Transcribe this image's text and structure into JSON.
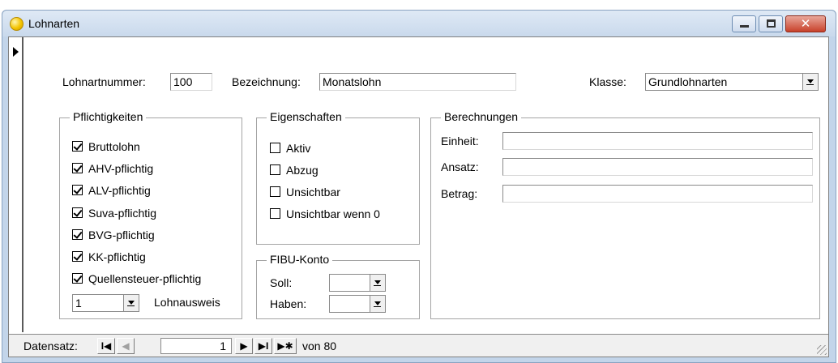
{
  "window": {
    "title": "Lohnarten",
    "close_glyph": "✕"
  },
  "header": {
    "lohnartnummer_label": "Lohnartnummer:",
    "lohnartnummer_value": "100",
    "bezeichnung_label": "Bezeichnung:",
    "bezeichnung_value": "Monatslohn",
    "klasse_label": "Klasse:",
    "klasse_value": "Grundlohnarten"
  },
  "pflichtigkeiten": {
    "title": "Pflichtigkeiten",
    "items": [
      {
        "label": "Bruttolohn",
        "checked": true
      },
      {
        "label": "AHV-pflichtig",
        "checked": true
      },
      {
        "label": "ALV-pflichtig",
        "checked": true
      },
      {
        "label": "Suva-pflichtig",
        "checked": true
      },
      {
        "label": "BVG-pflichtig",
        "checked": true
      },
      {
        "label": "KK-pflichtig",
        "checked": true
      },
      {
        "label": "Quellensteuer-pflichtig",
        "checked": true
      }
    ],
    "lohnausweis_value": "1",
    "lohnausweis_label": "Lohnausweis"
  },
  "eigenschaften": {
    "title": "Eigenschaften",
    "items": [
      {
        "label": "Aktiv",
        "checked": false
      },
      {
        "label": "Abzug",
        "checked": false
      },
      {
        "label": "Unsichtbar",
        "checked": false
      },
      {
        "label": "Unsichtbar wenn 0",
        "checked": false
      }
    ]
  },
  "fibu": {
    "title": "FIBU-Konto",
    "soll_label": "Soll:",
    "soll_value": "",
    "haben_label": "Haben:",
    "haben_value": ""
  },
  "berechnungen": {
    "title": "Berechnungen",
    "einheit_label": "Einheit:",
    "einheit_value": "",
    "ansatz_label": "Ansatz:",
    "ansatz_value": "",
    "betrag_label": "Betrag:",
    "betrag_value": ""
  },
  "navigation": {
    "label": "Datensatz:",
    "first_glyph": "I◀",
    "prev_glyph": "◀",
    "current": "1",
    "next_glyph": "▶",
    "last_glyph": "▶I",
    "new_glyph": "▶✱",
    "of_label": "von 80"
  }
}
